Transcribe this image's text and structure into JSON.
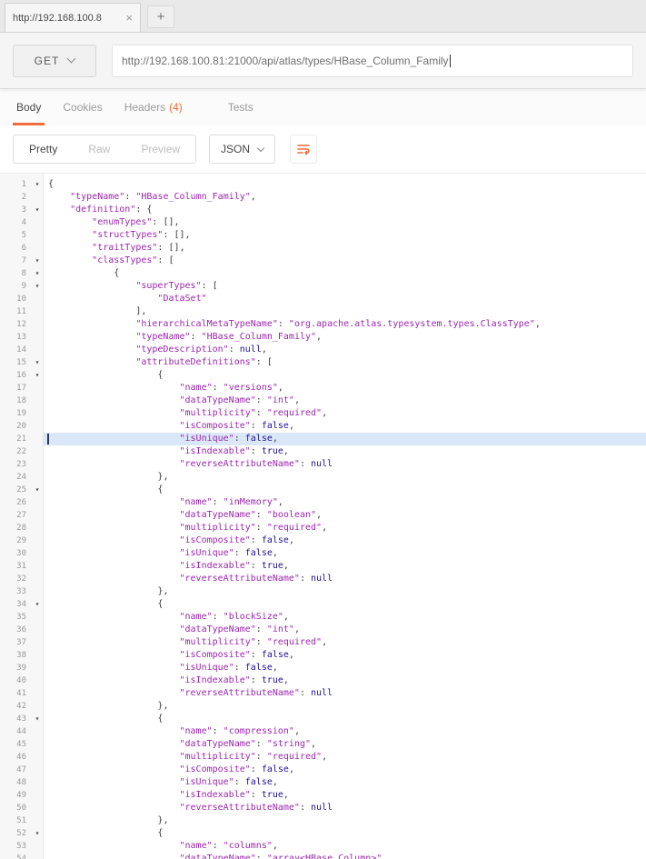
{
  "colors": {
    "accent": "#f26b3a",
    "string": "#9c27b0",
    "atom": "#221199",
    "punc": "#3b3b3b",
    "active_line": "#d9e7f8"
  },
  "browser": {
    "tab_title": "http://192.168.100.8",
    "close_label": "×",
    "new_tab_label": "+"
  },
  "request": {
    "method": "GET",
    "url": "http://192.168.100.81:21000/api/atlas/types/HBase_Column_Family"
  },
  "response_tabs": [
    {
      "label": "Body"
    },
    {
      "label": "Cookies"
    },
    {
      "label": "Headers",
      "badge": "(4)"
    },
    {
      "label": "Tests"
    }
  ],
  "view_toolbar": {
    "modes": [
      "Pretty",
      "Raw",
      "Preview"
    ],
    "active_mode": "Pretty",
    "format": "JSON",
    "wrap_icon": "wrap-lines-icon"
  },
  "editor": {
    "active_line": 21,
    "lines": [
      {
        "n": 1,
        "f": true,
        "t": [
          [
            "p",
            "{"
          ]
        ]
      },
      {
        "n": 2,
        "t": [
          [
            "w",
            "    "
          ],
          [
            "s",
            "\"typeName\""
          ],
          [
            "p",
            ": "
          ],
          [
            "s",
            "\"HBase_Column_Family\""
          ],
          [
            "p",
            ","
          ]
        ]
      },
      {
        "n": 3,
        "f": true,
        "t": [
          [
            "w",
            "    "
          ],
          [
            "s",
            "\"definition\""
          ],
          [
            "p",
            ": {"
          ]
        ]
      },
      {
        "n": 4,
        "t": [
          [
            "w",
            "        "
          ],
          [
            "s",
            "\"enumTypes\""
          ],
          [
            "p",
            ": [],"
          ]
        ]
      },
      {
        "n": 5,
        "t": [
          [
            "w",
            "        "
          ],
          [
            "s",
            "\"structTypes\""
          ],
          [
            "p",
            ": [],"
          ]
        ]
      },
      {
        "n": 6,
        "t": [
          [
            "w",
            "        "
          ],
          [
            "s",
            "\"traitTypes\""
          ],
          [
            "p",
            ": [],"
          ]
        ]
      },
      {
        "n": 7,
        "f": true,
        "t": [
          [
            "w",
            "        "
          ],
          [
            "s",
            "\"classTypes\""
          ],
          [
            "p",
            ": ["
          ]
        ]
      },
      {
        "n": 8,
        "f": true,
        "t": [
          [
            "w",
            "            "
          ],
          [
            "p",
            "{"
          ]
        ]
      },
      {
        "n": 9,
        "f": true,
        "t": [
          [
            "w",
            "                "
          ],
          [
            "s",
            "\"superTypes\""
          ],
          [
            "p",
            ": ["
          ]
        ]
      },
      {
        "n": 10,
        "t": [
          [
            "w",
            "                    "
          ],
          [
            "s",
            "\"DataSet\""
          ]
        ]
      },
      {
        "n": 11,
        "t": [
          [
            "w",
            "                "
          ],
          [
            "p",
            "],"
          ]
        ]
      },
      {
        "n": 12,
        "t": [
          [
            "w",
            "                "
          ],
          [
            "s",
            "\"hierarchicalMetaTypeName\""
          ],
          [
            "p",
            ": "
          ],
          [
            "s",
            "\"org.apache.atlas.typesystem.types.ClassType\""
          ],
          [
            "p",
            ","
          ]
        ]
      },
      {
        "n": 13,
        "t": [
          [
            "w",
            "                "
          ],
          [
            "s",
            "\"typeName\""
          ],
          [
            "p",
            ": "
          ],
          [
            "s",
            "\"HBase_Column_Family\""
          ],
          [
            "p",
            ","
          ]
        ]
      },
      {
        "n": 14,
        "t": [
          [
            "w",
            "                "
          ],
          [
            "s",
            "\"typeDescription\""
          ],
          [
            "p",
            ": "
          ],
          [
            "a",
            "null"
          ],
          [
            "p",
            ","
          ]
        ]
      },
      {
        "n": 15,
        "f": true,
        "t": [
          [
            "w",
            "                "
          ],
          [
            "s",
            "\"attributeDefinitions\""
          ],
          [
            "p",
            ": ["
          ]
        ]
      },
      {
        "n": 16,
        "f": true,
        "t": [
          [
            "w",
            "                    "
          ],
          [
            "p",
            "{"
          ]
        ]
      },
      {
        "n": 17,
        "t": [
          [
            "w",
            "                        "
          ],
          [
            "s",
            "\"name\""
          ],
          [
            "p",
            ": "
          ],
          [
            "s",
            "\"versions\""
          ],
          [
            "p",
            ","
          ]
        ]
      },
      {
        "n": 18,
        "t": [
          [
            "w",
            "                        "
          ],
          [
            "s",
            "\"dataTypeName\""
          ],
          [
            "p",
            ": "
          ],
          [
            "s",
            "\"int\""
          ],
          [
            "p",
            ","
          ]
        ]
      },
      {
        "n": 19,
        "t": [
          [
            "w",
            "                        "
          ],
          [
            "s",
            "\"multiplicity\""
          ],
          [
            "p",
            ": "
          ],
          [
            "s",
            "\"required\""
          ],
          [
            "p",
            ","
          ]
        ]
      },
      {
        "n": 20,
        "t": [
          [
            "w",
            "                        "
          ],
          [
            "s",
            "\"isComposite\""
          ],
          [
            "p",
            ": "
          ],
          [
            "a",
            "false"
          ],
          [
            "p",
            ","
          ]
        ]
      },
      {
        "n": 21,
        "a": true,
        "c": true,
        "t": [
          [
            "w",
            "                        "
          ],
          [
            "s",
            "\"isUnique\""
          ],
          [
            "p",
            ": "
          ],
          [
            "a",
            "false"
          ],
          [
            "p",
            ","
          ]
        ]
      },
      {
        "n": 22,
        "t": [
          [
            "w",
            "                        "
          ],
          [
            "s",
            "\"isIndexable\""
          ],
          [
            "p",
            ": "
          ],
          [
            "a",
            "true"
          ],
          [
            "p",
            ","
          ]
        ]
      },
      {
        "n": 23,
        "t": [
          [
            "w",
            "                        "
          ],
          [
            "s",
            "\"reverseAttributeName\""
          ],
          [
            "p",
            ": "
          ],
          [
            "a",
            "null"
          ]
        ]
      },
      {
        "n": 24,
        "t": [
          [
            "w",
            "                    "
          ],
          [
            "p",
            "},"
          ]
        ]
      },
      {
        "n": 25,
        "f": true,
        "t": [
          [
            "w",
            "                    "
          ],
          [
            "p",
            "{"
          ]
        ]
      },
      {
        "n": 26,
        "t": [
          [
            "w",
            "                        "
          ],
          [
            "s",
            "\"name\""
          ],
          [
            "p",
            ": "
          ],
          [
            "s",
            "\"inMemory\""
          ],
          [
            "p",
            ","
          ]
        ]
      },
      {
        "n": 27,
        "t": [
          [
            "w",
            "                        "
          ],
          [
            "s",
            "\"dataTypeName\""
          ],
          [
            "p",
            ": "
          ],
          [
            "s",
            "\"boolean\""
          ],
          [
            "p",
            ","
          ]
        ]
      },
      {
        "n": 28,
        "t": [
          [
            "w",
            "                        "
          ],
          [
            "s",
            "\"multiplicity\""
          ],
          [
            "p",
            ": "
          ],
          [
            "s",
            "\"required\""
          ],
          [
            "p",
            ","
          ]
        ]
      },
      {
        "n": 29,
        "t": [
          [
            "w",
            "                        "
          ],
          [
            "s",
            "\"isComposite\""
          ],
          [
            "p",
            ": "
          ],
          [
            "a",
            "false"
          ],
          [
            "p",
            ","
          ]
        ]
      },
      {
        "n": 30,
        "t": [
          [
            "w",
            "                        "
          ],
          [
            "s",
            "\"isUnique\""
          ],
          [
            "p",
            ": "
          ],
          [
            "a",
            "false"
          ],
          [
            "p",
            ","
          ]
        ]
      },
      {
        "n": 31,
        "t": [
          [
            "w",
            "                        "
          ],
          [
            "s",
            "\"isIndexable\""
          ],
          [
            "p",
            ": "
          ],
          [
            "a",
            "true"
          ],
          [
            "p",
            ","
          ]
        ]
      },
      {
        "n": 32,
        "t": [
          [
            "w",
            "                        "
          ],
          [
            "s",
            "\"reverseAttributeName\""
          ],
          [
            "p",
            ": "
          ],
          [
            "a",
            "null"
          ]
        ]
      },
      {
        "n": 33,
        "t": [
          [
            "w",
            "                    "
          ],
          [
            "p",
            "},"
          ]
        ]
      },
      {
        "n": 34,
        "f": true,
        "t": [
          [
            "w",
            "                    "
          ],
          [
            "p",
            "{"
          ]
        ]
      },
      {
        "n": 35,
        "t": [
          [
            "w",
            "                        "
          ],
          [
            "s",
            "\"name\""
          ],
          [
            "p",
            ": "
          ],
          [
            "s",
            "\"blockSize\""
          ],
          [
            "p",
            ","
          ]
        ]
      },
      {
        "n": 36,
        "t": [
          [
            "w",
            "                        "
          ],
          [
            "s",
            "\"dataTypeName\""
          ],
          [
            "p",
            ": "
          ],
          [
            "s",
            "\"int\""
          ],
          [
            "p",
            ","
          ]
        ]
      },
      {
        "n": 37,
        "t": [
          [
            "w",
            "                        "
          ],
          [
            "s",
            "\"multiplicity\""
          ],
          [
            "p",
            ": "
          ],
          [
            "s",
            "\"required\""
          ],
          [
            "p",
            ","
          ]
        ]
      },
      {
        "n": 38,
        "t": [
          [
            "w",
            "                        "
          ],
          [
            "s",
            "\"isComposite\""
          ],
          [
            "p",
            ": "
          ],
          [
            "a",
            "false"
          ],
          [
            "p",
            ","
          ]
        ]
      },
      {
        "n": 39,
        "t": [
          [
            "w",
            "                        "
          ],
          [
            "s",
            "\"isUnique\""
          ],
          [
            "p",
            ": "
          ],
          [
            "a",
            "false"
          ],
          [
            "p",
            ","
          ]
        ]
      },
      {
        "n": 40,
        "t": [
          [
            "w",
            "                        "
          ],
          [
            "s",
            "\"isIndexable\""
          ],
          [
            "p",
            ": "
          ],
          [
            "a",
            "true"
          ],
          [
            "p",
            ","
          ]
        ]
      },
      {
        "n": 41,
        "t": [
          [
            "w",
            "                        "
          ],
          [
            "s",
            "\"reverseAttributeName\""
          ],
          [
            "p",
            ": "
          ],
          [
            "a",
            "null"
          ]
        ]
      },
      {
        "n": 42,
        "t": [
          [
            "w",
            "                    "
          ],
          [
            "p",
            "},"
          ]
        ]
      },
      {
        "n": 43,
        "f": true,
        "t": [
          [
            "w",
            "                    "
          ],
          [
            "p",
            "{"
          ]
        ]
      },
      {
        "n": 44,
        "t": [
          [
            "w",
            "                        "
          ],
          [
            "s",
            "\"name\""
          ],
          [
            "p",
            ": "
          ],
          [
            "s",
            "\"compression\""
          ],
          [
            "p",
            ","
          ]
        ]
      },
      {
        "n": 45,
        "t": [
          [
            "w",
            "                        "
          ],
          [
            "s",
            "\"dataTypeName\""
          ],
          [
            "p",
            ": "
          ],
          [
            "s",
            "\"string\""
          ],
          [
            "p",
            ","
          ]
        ]
      },
      {
        "n": 46,
        "t": [
          [
            "w",
            "                        "
          ],
          [
            "s",
            "\"multiplicity\""
          ],
          [
            "p",
            ": "
          ],
          [
            "s",
            "\"required\""
          ],
          [
            "p",
            ","
          ]
        ]
      },
      {
        "n": 47,
        "t": [
          [
            "w",
            "                        "
          ],
          [
            "s",
            "\"isComposite\""
          ],
          [
            "p",
            ": "
          ],
          [
            "a",
            "false"
          ],
          [
            "p",
            ","
          ]
        ]
      },
      {
        "n": 48,
        "t": [
          [
            "w",
            "                        "
          ],
          [
            "s",
            "\"isUnique\""
          ],
          [
            "p",
            ": "
          ],
          [
            "a",
            "false"
          ],
          [
            "p",
            ","
          ]
        ]
      },
      {
        "n": 49,
        "t": [
          [
            "w",
            "                        "
          ],
          [
            "s",
            "\"isIndexable\""
          ],
          [
            "p",
            ": "
          ],
          [
            "a",
            "true"
          ],
          [
            "p",
            ","
          ]
        ]
      },
      {
        "n": 50,
        "t": [
          [
            "w",
            "                        "
          ],
          [
            "s",
            "\"reverseAttributeName\""
          ],
          [
            "p",
            ": "
          ],
          [
            "a",
            "null"
          ]
        ]
      },
      {
        "n": 51,
        "t": [
          [
            "w",
            "                    "
          ],
          [
            "p",
            "},"
          ]
        ]
      },
      {
        "n": 52,
        "f": true,
        "t": [
          [
            "w",
            "                    "
          ],
          [
            "p",
            "{"
          ]
        ]
      },
      {
        "n": 53,
        "t": [
          [
            "w",
            "                        "
          ],
          [
            "s",
            "\"name\""
          ],
          [
            "p",
            ": "
          ],
          [
            "s",
            "\"columns\""
          ],
          [
            "p",
            ","
          ]
        ]
      },
      {
        "n": 54,
        "t": [
          [
            "w",
            "                        "
          ],
          [
            "s",
            "\"dataTypeName\""
          ],
          [
            "p",
            ": "
          ],
          [
            "s",
            "\"array<HBase_Column>\""
          ],
          [
            "p",
            ","
          ]
        ]
      }
    ]
  }
}
